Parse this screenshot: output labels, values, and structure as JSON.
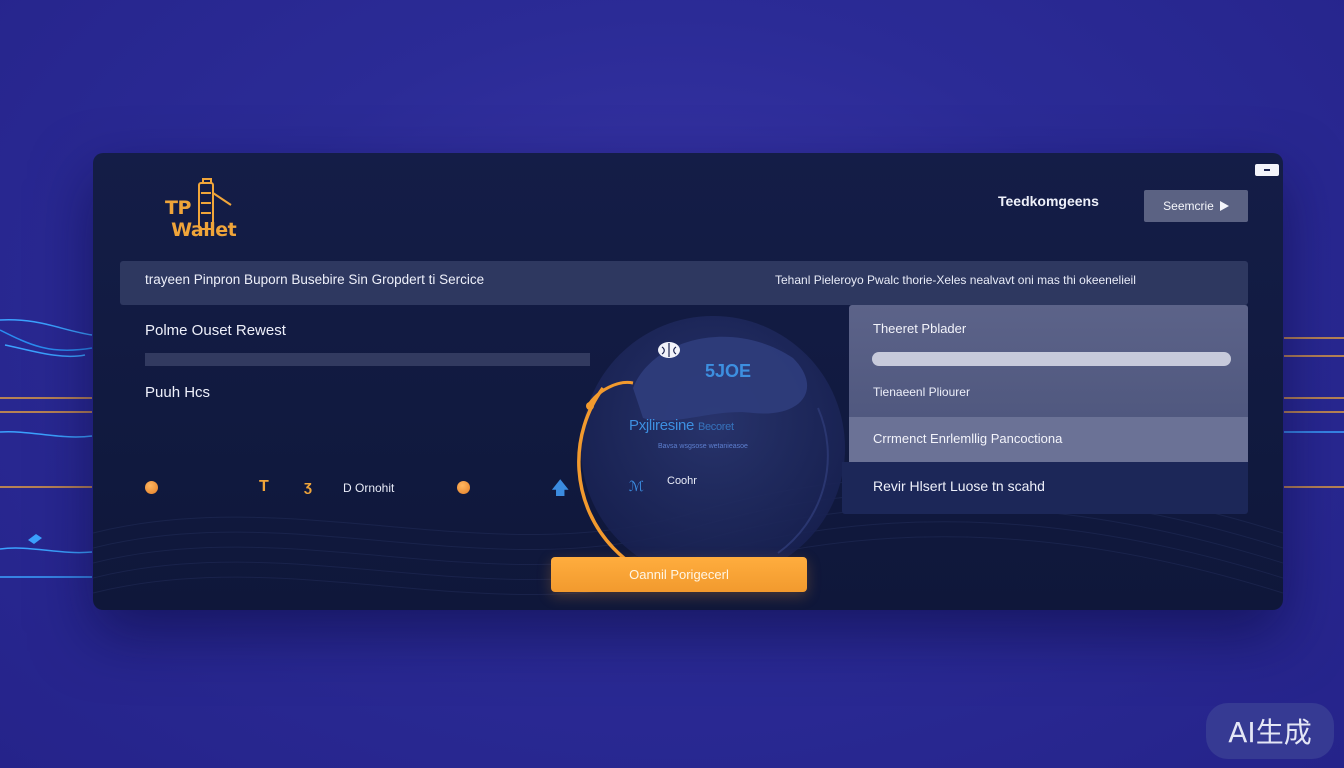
{
  "app": {
    "logo_text": "TP   Wallet",
    "header_label": "Teedkomgeens",
    "header_button_label": "Seemcrie"
  },
  "banner": {
    "left_text": "trayeen Pinpron Buporn Busebire Sin Gropdert ti Sercice",
    "right_text": "Tehanl Pieleroyo Pwalc thorie-Xeles nealvavt oni mas thi okeenelieil"
  },
  "left": {
    "title": "Polme Ouset Rewest",
    "subtitle": "Puuh Hcs",
    "row_label": "D Ornohit",
    "t_glyph": "T",
    "s_glyph": "ʒ"
  },
  "center": {
    "tag": "5JOE",
    "title": "Pxjliresine",
    "title_suffix": "Becoret",
    "caption": "Bavsa wsgsose wetanieasoe",
    "label": "Coohr"
  },
  "right_panel": {
    "title": "Theeret Pblader",
    "slider_value": 1.0,
    "subtitle": "Tienaeenl Pliourer",
    "selected_item": "Crrmenct Enrlemllig Pancoctiona",
    "bottom_item": "Revir Hlsert Luose tn scahd"
  },
  "cta": {
    "label": "Oannil Porigecerl"
  },
  "watermark": {
    "label": "AI生成"
  },
  "colors": {
    "accent": "#f29a2e",
    "background": "#2b2b96",
    "panel": "#131c44",
    "blue_accent": "#3d8fe0"
  }
}
